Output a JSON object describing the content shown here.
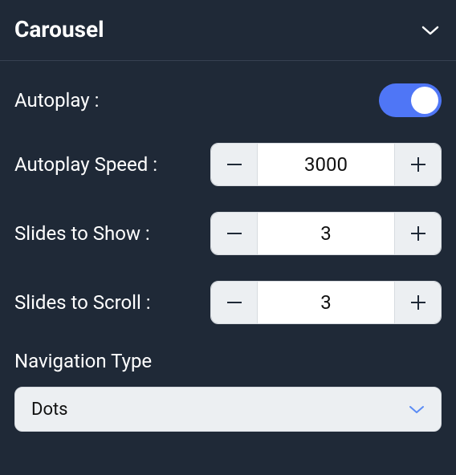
{
  "panel": {
    "title": "Carousel"
  },
  "fields": {
    "autoplay": {
      "label": "Autoplay :",
      "value": true
    },
    "autoplay_speed": {
      "label": "Autoplay Speed :",
      "value": "3000"
    },
    "slides_to_show": {
      "label": "Slides to Show :",
      "value": "3"
    },
    "slides_to_scroll": {
      "label": "Slides to Scroll :",
      "value": "3"
    },
    "navigation_type": {
      "label": "Navigation Type",
      "value": "Dots"
    }
  },
  "colors": {
    "bg": "#1f2937",
    "accent": "#4f76f6",
    "input_bg": "#eceff2",
    "select_chevron": "#5b8cf5"
  }
}
